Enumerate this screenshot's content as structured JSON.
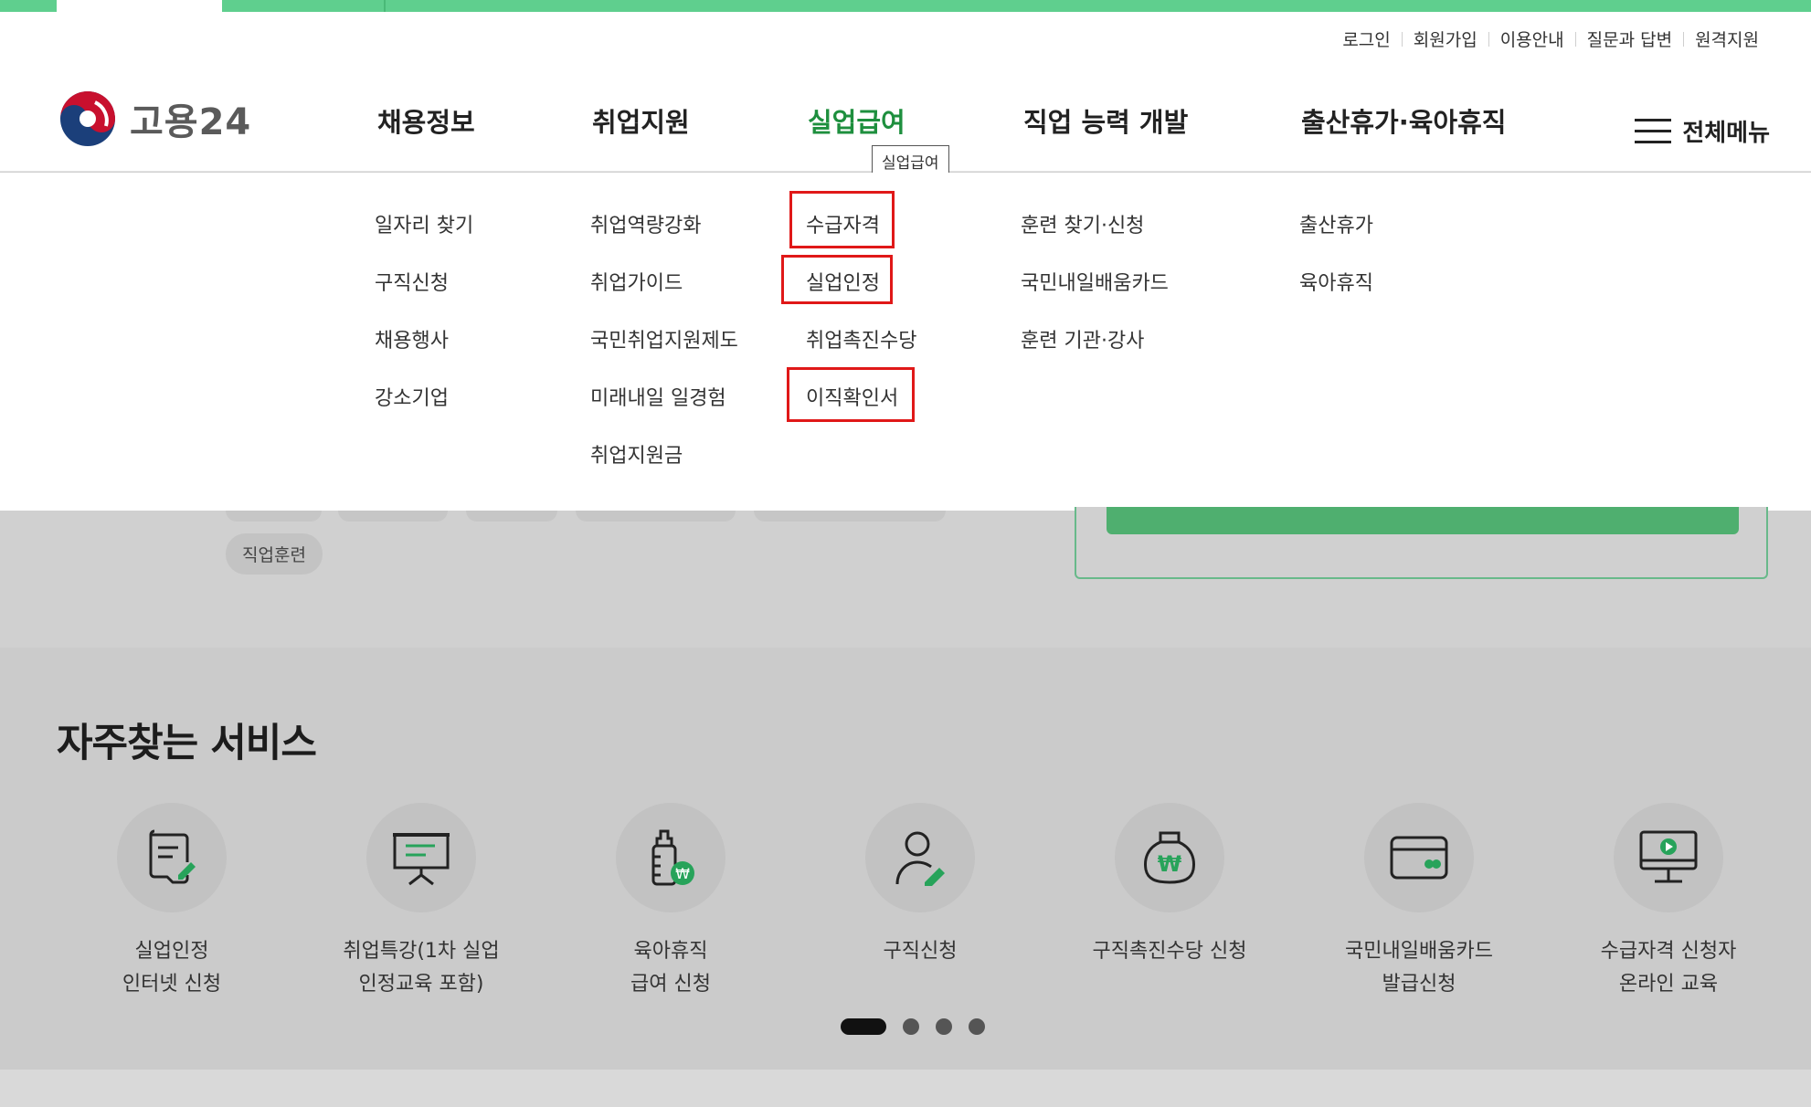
{
  "util_links": [
    "로그인",
    "회원가입",
    "이용안내",
    "질문과 답변",
    "원격지원"
  ],
  "logo": {
    "text": "고용24"
  },
  "gnb": [
    {
      "label": "채용정보"
    },
    {
      "label": "취업지원"
    },
    {
      "label": "실업급여",
      "active": true
    },
    {
      "label": "직업 능력 개발"
    },
    {
      "label": "출산휴가·육아휴직"
    }
  ],
  "tooltip": "실업급여",
  "all_menu": "전체메뉴",
  "submenu": {
    "col1": [
      "일자리 찾기",
      "구직신청",
      "채용행사",
      "강소기업"
    ],
    "col2": [
      "취업역량강화",
      "취업가이드",
      "국민취업지원제도",
      "미래내일 일경험",
      "취업지원금"
    ],
    "col3": [
      "수급자격",
      "실업인정",
      "취업촉진수당",
      "이직확인서"
    ],
    "col4": [
      "훈련 찾기·신청",
      "국민내일배움카드",
      "훈련 기관·강사"
    ],
    "col5": [
      "출산휴가",
      "육아휴직"
    ]
  },
  "chip": "직업훈련",
  "frequent": {
    "title": "자주찾는 서비스",
    "items": [
      {
        "line1": "실업인정",
        "line2": "인터넷 신청",
        "icon": "document-edit-icon"
      },
      {
        "line1": "취업특강(1차 실업",
        "line2": "인정교육 포함)",
        "icon": "presentation-board-icon"
      },
      {
        "line1": "육아휴직",
        "line2": "급여 신청",
        "icon": "baby-bottle-won-icon"
      },
      {
        "line1": "구직신청",
        "line2": "",
        "icon": "person-edit-icon"
      },
      {
        "line1": "구직촉진수당 신청",
        "line2": "",
        "icon": "money-bag-won-icon"
      },
      {
        "line1": "국민내일배움카드",
        "line2": "발급신청",
        "icon": "card-icon"
      },
      {
        "line1": "수급자격 신청자",
        "line2": "온라인 교육",
        "icon": "monitor-play-icon"
      }
    ]
  },
  "carousel": {
    "pages": 4,
    "current": 1
  },
  "colors": {
    "accent": "#1e8f3e",
    "topbar": "#5fcf8e",
    "highlight": "#e01818"
  }
}
